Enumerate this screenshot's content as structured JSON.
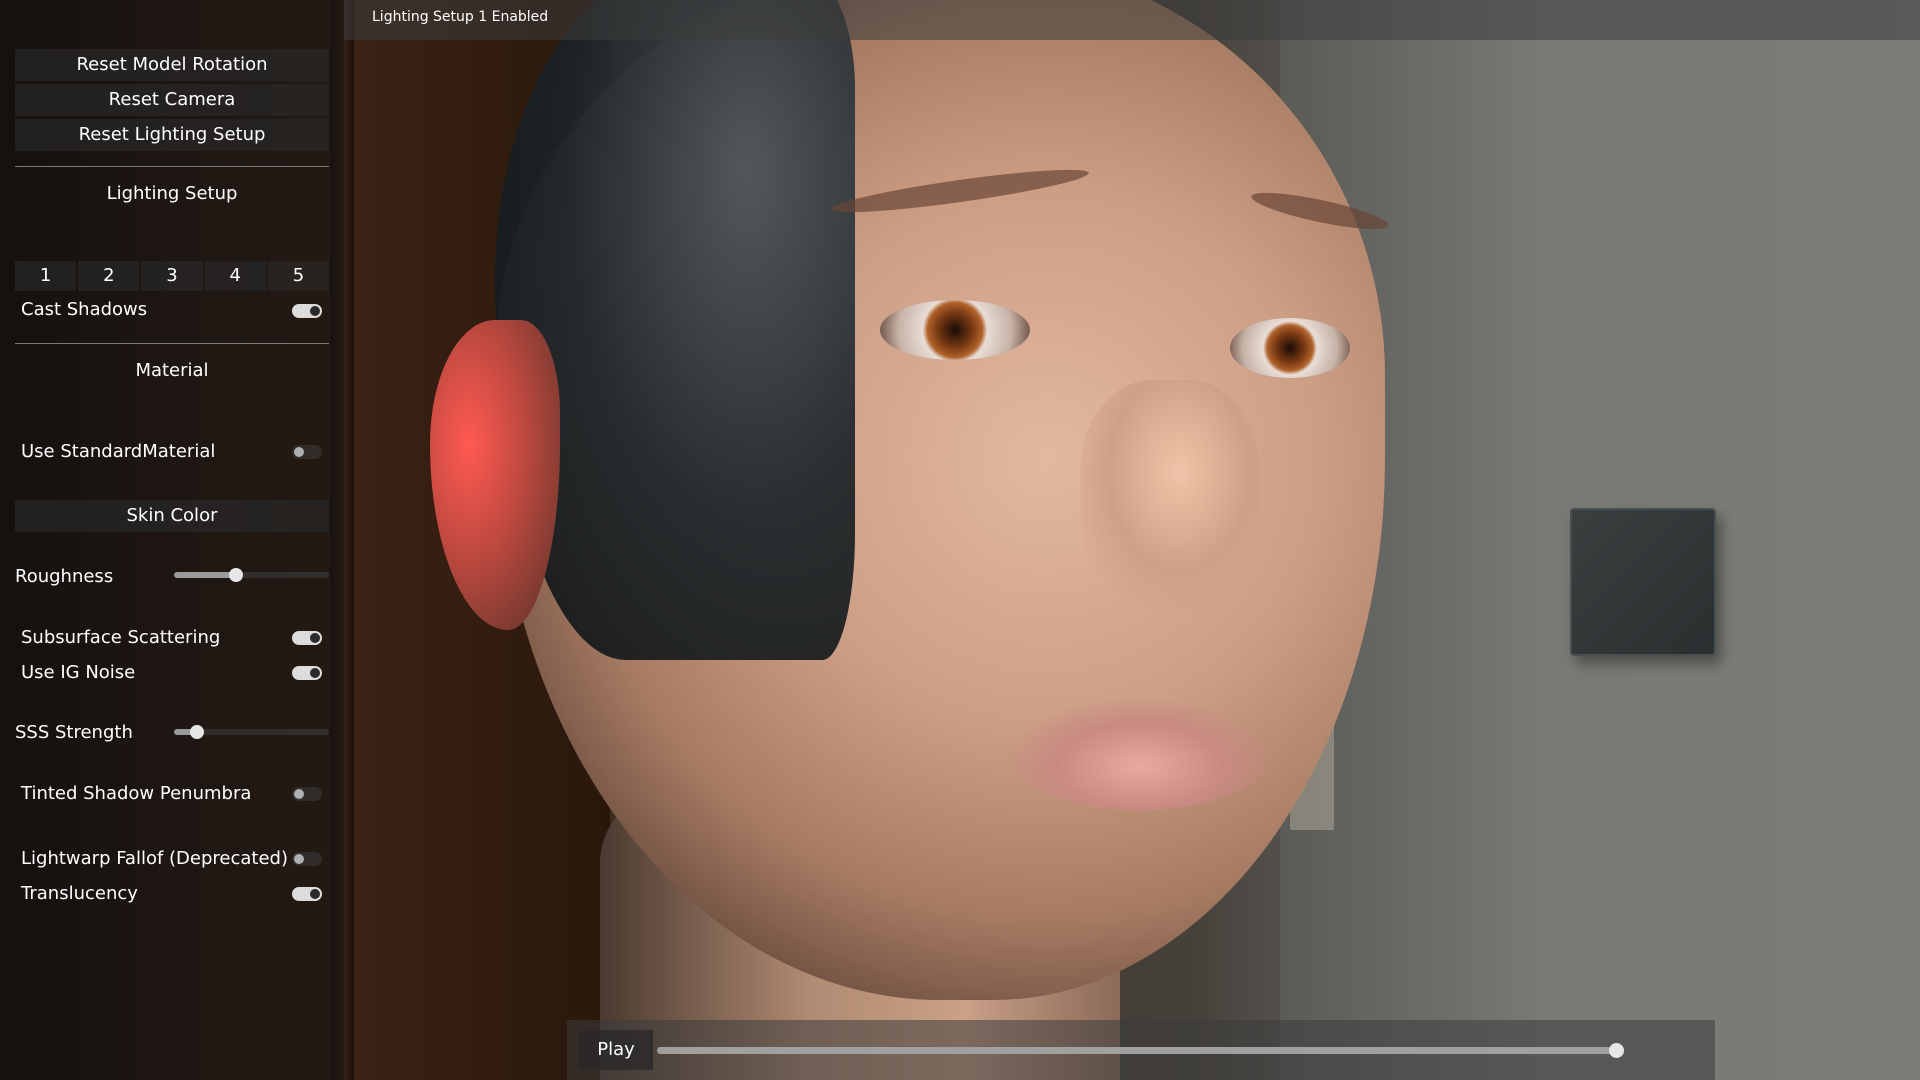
{
  "status": {
    "text": "Lighting Setup 1 Enabled"
  },
  "panel": {
    "buttons": {
      "reset_model_rotation": "Reset Model Rotation",
      "reset_camera": "Reset Camera",
      "reset_lighting_setup": "Reset Lighting Setup"
    },
    "lighting": {
      "title": "Lighting Setup",
      "presets": [
        "1",
        "2",
        "3",
        "4",
        "5"
      ],
      "cast_shadows": {
        "label": "Cast Shadows",
        "on": true
      }
    },
    "material": {
      "title": "Material",
      "use_standard_material": {
        "label": "Use StandardMaterial",
        "on": false
      },
      "skin_color_button": "Skin Color",
      "roughness": {
        "label": "Roughness",
        "value": 0.4
      },
      "subsurface_scattering": {
        "label": "Subsurface Scattering",
        "on": true
      },
      "use_ig_noise": {
        "label": "Use IG Noise",
        "on": true
      },
      "sss_strength": {
        "label": "SSS Strength",
        "value": 0.15
      },
      "tinted_shadow_penumbra": {
        "label": "Tinted Shadow Penumbra",
        "on": false
      },
      "lightwarp_falloff": {
        "label": "Lightwarp Fallof (Deprecated)",
        "on": false
      },
      "translucency": {
        "label": "Translucency",
        "on": true
      }
    }
  },
  "playback": {
    "play_label": "Play",
    "progress": 0.915
  }
}
